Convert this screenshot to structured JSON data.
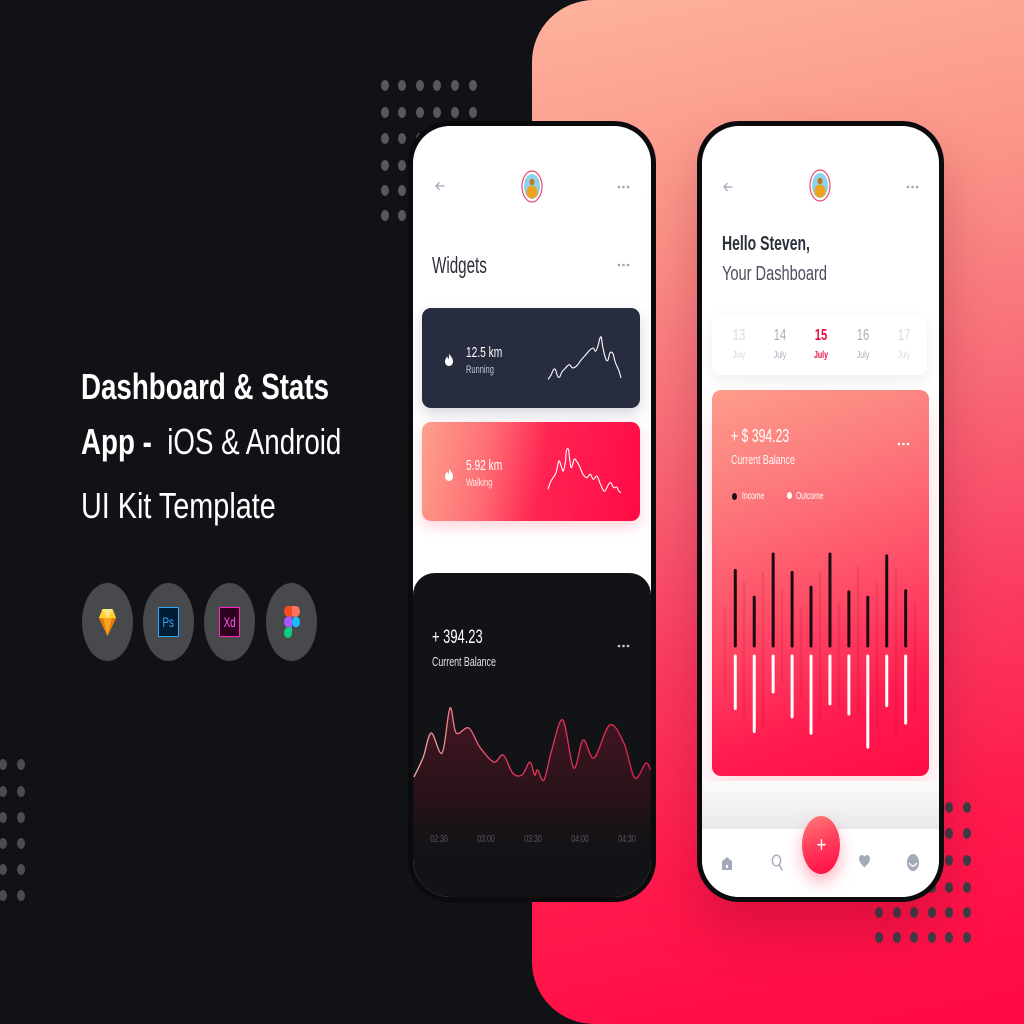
{
  "promo": {
    "title_line1": "Dashboard & Stats",
    "title_line2_bold": "App - ",
    "title_line2_light": " iOS & Android",
    "title_line3": "UI Kit Template",
    "tool_icons": [
      "sketch-icon",
      "photoshop-icon",
      "adobe-xd-icon",
      "figma-icon"
    ],
    "ps_label": "Ps",
    "xd_label": "Xd"
  },
  "widgets_screen": {
    "header_icons": [
      "arrow-left-icon",
      "avatar",
      "more-horizontal-icon"
    ],
    "section_title": "Widgets",
    "widgets": [
      {
        "value": "12.5 km",
        "label": "Running",
        "icon": "flame-icon"
      },
      {
        "value": "5.92 km",
        "label": "Walking",
        "icon": "flame-icon"
      }
    ],
    "balance": {
      "amount": "+ 394.23",
      "label": "Current Balance"
    }
  },
  "dashboard_screen": {
    "header_icons": [
      "arrow-left-icon",
      "avatar",
      "more-horizontal-icon"
    ],
    "greeting": "Hello Steven,",
    "subtitle": "Your Dashboard",
    "dates": [
      {
        "day": "13",
        "month": "July",
        "state": "faded"
      },
      {
        "day": "14",
        "month": "July",
        "state": "normal"
      },
      {
        "day": "15",
        "month": "July",
        "state": "selected"
      },
      {
        "day": "16",
        "month": "July",
        "state": "normal"
      },
      {
        "day": "17",
        "month": "July",
        "state": "faded"
      }
    ],
    "balance": {
      "amount": "+ $ 394.23",
      "label": "Current Balance"
    },
    "fab_label": "+",
    "nav_icons": [
      "home-icon",
      "search-icon",
      "add-icon",
      "heart-icon",
      "profile-icon"
    ]
  },
  "colors": {
    "accent": "#ff0844",
    "accent_light": "#fdb29c",
    "running_card": "#272c3e",
    "selected_date": "#e3103f",
    "background": "#111216"
  },
  "chart_data": [
    {
      "type": "area",
      "title": "Current Balance",
      "x_unit": "minutes since 00:00",
      "x": [
        134,
        140,
        145,
        152,
        157,
        161,
        169,
        176,
        185,
        191,
        197,
        203,
        208,
        211,
        213,
        217,
        222,
        229,
        236,
        242,
        249,
        259,
        268,
        275,
        282,
        285
      ],
      "values": [
        13,
        33,
        57,
        37,
        82,
        57,
        62,
        43,
        28,
        35,
        17,
        15,
        28,
        15,
        20,
        10,
        40,
        70,
        22,
        50,
        32,
        65,
        47,
        12,
        27,
        20
      ],
      "y_unit": "relative",
      "x_ticks": [
        "02:30",
        "03:00",
        "03:30",
        "04:00",
        "04:30"
      ],
      "x_tick_values": [
        150,
        180,
        210,
        240,
        270
      ],
      "grid": false
    },
    {
      "type": "bar",
      "title": "Income / Outcome",
      "y_unit": "relative (max = 100)",
      "series": [
        {
          "name": "Income",
          "color": "#1b0a0f",
          "values": [
            82,
            53,
            100,
            80,
            64,
            100,
            59,
            53,
            98,
            60
          ]
        },
        {
          "name": "Outcome",
          "color": "#ffffff",
          "values": [
            57,
            82,
            39,
            66,
            84,
            52,
            63,
            99,
            54,
            73
          ]
        }
      ],
      "background_bars": {
        "up": [
          47,
          74,
          85,
          66,
          47,
          85,
          52,
          91,
          74,
          88,
          52
        ],
        "down": [
          46,
          71,
          82,
          35,
          50,
          75,
          61,
          68,
          82,
          89,
          64
        ]
      },
      "legend": "top-left"
    },
    {
      "type": "line",
      "title": "Running",
      "x_unit": "relative progress (0-100)",
      "points": [
        [
          0,
          8
        ],
        [
          4,
          20
        ],
        [
          7,
          35
        ],
        [
          10,
          38
        ],
        [
          13,
          18
        ],
        [
          16,
          15
        ],
        [
          19,
          30
        ],
        [
          24,
          42
        ],
        [
          29,
          52
        ],
        [
          34,
          42
        ],
        [
          40,
          50
        ],
        [
          45,
          65
        ],
        [
          51,
          80
        ],
        [
          57,
          95
        ],
        [
          62,
          102
        ],
        [
          65,
          92
        ],
        [
          68,
          105
        ],
        [
          71,
          130
        ],
        [
          73,
          134
        ],
        [
          75,
          105
        ],
        [
          79,
          70
        ],
        [
          82,
          65
        ],
        [
          85,
          88
        ],
        [
          89,
          85
        ],
        [
          92,
          60
        ],
        [
          97,
          35
        ],
        [
          100,
          12
        ]
      ]
    },
    {
      "type": "line",
      "title": "Walking",
      "x_unit": "relative progress (0-100)",
      "points": [
        [
          0,
          20
        ],
        [
          3,
          40
        ],
        [
          7,
          55
        ],
        [
          11,
          70
        ],
        [
          15,
          105
        ],
        [
          18,
          90
        ],
        [
          21,
          75
        ],
        [
          24,
          105
        ],
        [
          25,
          135
        ],
        [
          28,
          140
        ],
        [
          30,
          105
        ],
        [
          32,
          85
        ],
        [
          36,
          110
        ],
        [
          39,
          105
        ],
        [
          43,
          90
        ],
        [
          48,
          65
        ],
        [
          53,
          55
        ],
        [
          58,
          65
        ],
        [
          62,
          50
        ],
        [
          67,
          60
        ],
        [
          71,
          40
        ],
        [
          75,
          20
        ],
        [
          78,
          15
        ],
        [
          83,
          35
        ],
        [
          86,
          40
        ],
        [
          90,
          25
        ],
        [
          94,
          27
        ],
        [
          97,
          15
        ],
        [
          100,
          10
        ]
      ]
    }
  ]
}
